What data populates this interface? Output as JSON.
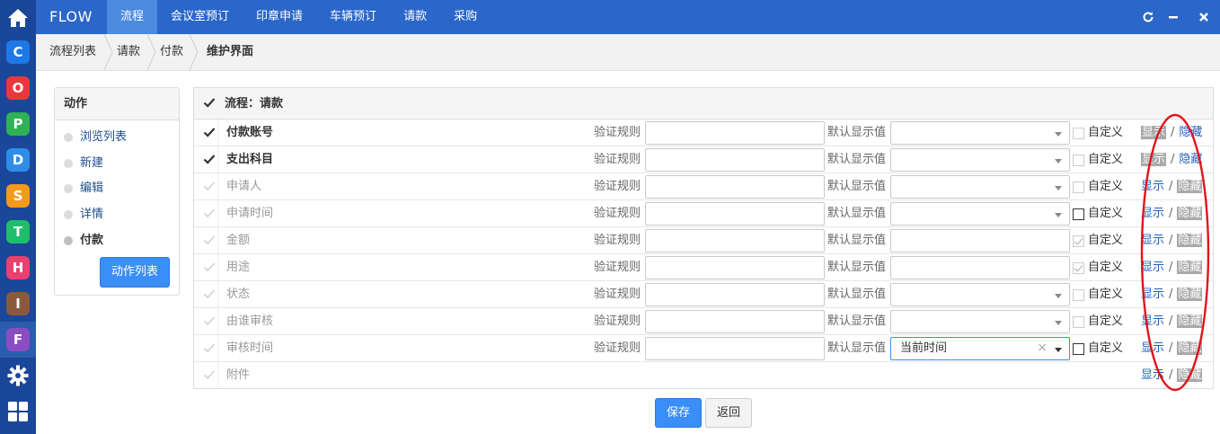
{
  "app": {
    "brand": "FLOW"
  },
  "nav": [
    {
      "label": "流程",
      "active": true
    },
    {
      "label": "会议室预订",
      "active": false
    },
    {
      "label": "印章申请",
      "active": false
    },
    {
      "label": "车辆预订",
      "active": false
    },
    {
      "label": "请款",
      "active": false
    },
    {
      "label": "采购",
      "active": false
    }
  ],
  "window_controls": [
    "refresh-icon",
    "minimize-icon",
    "close-icon"
  ],
  "rail": [
    {
      "icon": "home-icon"
    },
    {
      "letter": "C",
      "color": "#1e78e8"
    },
    {
      "letter": "O",
      "color": "#e8383b"
    },
    {
      "letter": "P",
      "color": "#2fb254"
    },
    {
      "letter": "D",
      "color": "#2f8de8"
    },
    {
      "letter": "S",
      "color": "#f39a1e"
    },
    {
      "letter": "T",
      "color": "#1fbe6a"
    },
    {
      "letter": "H",
      "color": "#e8416f"
    },
    {
      "letter": "I",
      "color": "#8a5a3c"
    },
    {
      "letter": "F",
      "color": "#8a4ec2",
      "active": true
    },
    {
      "icon": "gear-icon"
    },
    {
      "icon": "grid-icon"
    }
  ],
  "breadcrumb": [
    "流程列表",
    "请款",
    "付款",
    "维护界面"
  ],
  "actions": {
    "title": "动作",
    "items": [
      {
        "label": "浏览列表",
        "current": false
      },
      {
        "label": "新建",
        "current": false
      },
      {
        "label": "编辑",
        "current": false
      },
      {
        "label": "详情",
        "current": false
      },
      {
        "label": "付款",
        "current": true
      }
    ],
    "button": "动作列表"
  },
  "grid": {
    "title": "流程：请款",
    "labels": {
      "validation": "验证规则",
      "default": "默认显示值",
      "custom": "自定义",
      "show": "显示",
      "slash": "/",
      "hide": "隐藏"
    },
    "rows": [
      {
        "name": "付款账号",
        "enabled": true,
        "select": true,
        "select_value": "",
        "custom_checked": false,
        "custom_style": "light",
        "visible": "show"
      },
      {
        "name": "支出科目",
        "enabled": true,
        "select": true,
        "select_value": "",
        "custom_checked": false,
        "custom_style": "light",
        "visible": "show"
      },
      {
        "name": "申请人",
        "enabled": false,
        "select": true,
        "select_value": "",
        "custom_checked": false,
        "custom_style": "light",
        "visible": "hide"
      },
      {
        "name": "申请时间",
        "enabled": false,
        "select": true,
        "select_value": "",
        "custom_checked": false,
        "custom_style": "dark",
        "visible": "hide"
      },
      {
        "name": "金额",
        "enabled": false,
        "select": false,
        "select_value": "",
        "custom_checked": true,
        "custom_style": "light",
        "visible": "hide"
      },
      {
        "name": "用途",
        "enabled": false,
        "select": false,
        "select_value": "",
        "custom_checked": true,
        "custom_style": "light",
        "visible": "hide"
      },
      {
        "name": "状态",
        "enabled": false,
        "select": true,
        "select_value": "",
        "custom_checked": false,
        "custom_style": "light",
        "visible": "hide"
      },
      {
        "name": "由谁审核",
        "enabled": false,
        "select": true,
        "select_value": "",
        "custom_checked": false,
        "custom_style": "light",
        "visible": "hide"
      },
      {
        "name": "审核时间",
        "enabled": false,
        "select": true,
        "select_value": "当前时间",
        "select_clear": "×",
        "custom_checked": false,
        "custom_style": "dark",
        "visible": "hide"
      },
      {
        "name": "附件",
        "enabled": false,
        "attachment": true,
        "visible": "hide"
      }
    ]
  },
  "footer": {
    "save": "保存",
    "back": "返回"
  },
  "annotation": {
    "shape": "ellipse",
    "color": "#e0141c"
  }
}
